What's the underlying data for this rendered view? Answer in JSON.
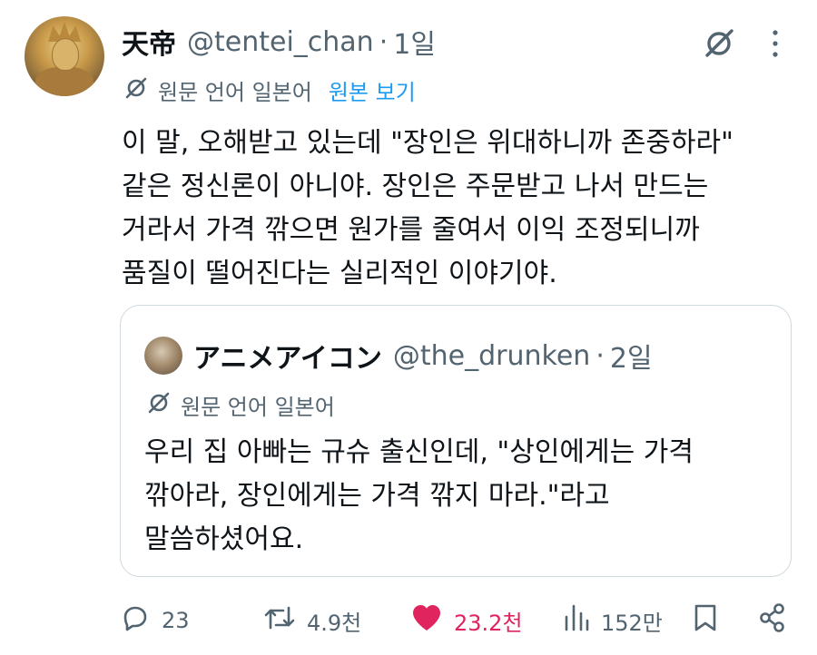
{
  "tweet": {
    "author_name": "天帝",
    "handle": "@tentei_chan",
    "separator": "·",
    "time": "1일",
    "translation": {
      "label": "원문 언어 일본어",
      "show_original": "원본 보기"
    },
    "text_lines": [
      "이 말, 오해받고 있는데 \"장인은 위대하니까 존중하라\"",
      "같은 정신론이 아니야. 장인은 주문받고 나서 만드는",
      "거라서 가격 깎으면 원가를 줄여서 이익 조정되니까",
      "품질이 떨어진다는 실리적인 이야기야."
    ]
  },
  "quote": {
    "author_name": "アニメアイコン",
    "handle": "@the_drunken",
    "separator": "·",
    "time": "2일",
    "translation_label": "원문 언어 일본어",
    "text_lines": [
      "우리 집 아빠는 규슈 출신인데, \"상인에게는 가격",
      "깎아라, 장인에게는 가격 깎지 마라.\"라고",
      "말씀하셨어요."
    ]
  },
  "actions": {
    "replies": "23",
    "reposts": "4.9천",
    "likes": "23.2천",
    "views": "152만"
  },
  "icons": {
    "grok": "grok-icon",
    "more": "more-dots-icon",
    "translate": "translate-icon",
    "reply": "reply-icon",
    "repost": "repost-icon",
    "like": "heart-icon",
    "views": "views-chart-icon",
    "bookmark": "bookmark-icon",
    "share": "share-icon"
  },
  "colors": {
    "text": "#0f1419",
    "secondary": "#536471",
    "link": "#1d9bf0",
    "liked": "#e0245e",
    "border": "#cfd9de"
  }
}
